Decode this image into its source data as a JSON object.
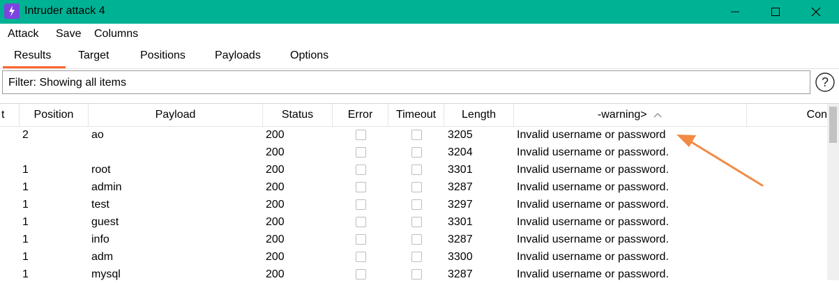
{
  "window": {
    "title": "Intruder attack 4"
  },
  "menu": [
    "Attack",
    "Save",
    "Columns"
  ],
  "tabs": [
    "Results",
    "Target",
    "Positions",
    "Payloads",
    "Options"
  ],
  "filter": {
    "text": "Filter: Showing all items"
  },
  "help": {
    "label": "?"
  },
  "table": {
    "headers": [
      "t",
      "Position",
      "Payload",
      "Status",
      "Error",
      "Timeout",
      "Length",
      "-warning>",
      "Con"
    ],
    "sort_indicator": "^",
    "rows": [
      {
        "position": "2",
        "payload": "ao",
        "status": "200",
        "length": "3205",
        "warning": "Invalid username or password"
      },
      {
        "position": "",
        "payload": "",
        "status": "200",
        "length": "3204",
        "warning": "Invalid username or password."
      },
      {
        "position": "1",
        "payload": "root",
        "status": "200",
        "length": "3301",
        "warning": "Invalid username or password."
      },
      {
        "position": "1",
        "payload": "admin",
        "status": "200",
        "length": "3287",
        "warning": "Invalid username or password."
      },
      {
        "position": "1",
        "payload": "test",
        "status": "200",
        "length": "3297",
        "warning": "Invalid username or password."
      },
      {
        "position": "1",
        "payload": "guest",
        "status": "200",
        "length": "3301",
        "warning": "Invalid username or password."
      },
      {
        "position": "1",
        "payload": "info",
        "status": "200",
        "length": "3287",
        "warning": "Invalid username or password."
      },
      {
        "position": "1",
        "payload": "adm",
        "status": "200",
        "length": "3300",
        "warning": "Invalid username or password."
      },
      {
        "position": "1",
        "payload": "mysql",
        "status": "200",
        "length": "3287",
        "warning": "Invalid username or password."
      }
    ]
  },
  "colors": {
    "titlebar": "#00b294",
    "tab_accent": "#ff6633",
    "annotation_arrow": "#f28a44"
  }
}
